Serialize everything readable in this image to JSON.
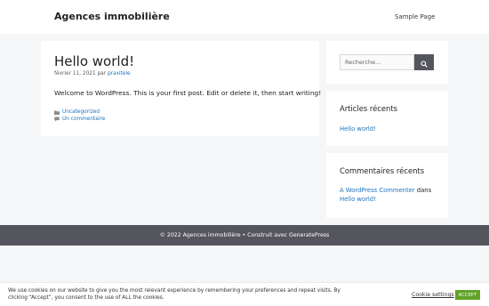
{
  "header": {
    "site_title": "Agences immobilière",
    "nav": [
      {
        "label": "Sample Page"
      }
    ]
  },
  "post": {
    "title": "Hello world!",
    "date": "février 11, 2021",
    "by": "par",
    "author": "praxitele",
    "body": "Welcome to WordPress. This is your first post. Edit or delete it, then start writing!",
    "category": "Uncategorized",
    "comments_link": "Un commentaire",
    "icons": [
      "folder-icon",
      "comment-icon"
    ]
  },
  "sidebar": {
    "search": {
      "placeholder": "Recherche...",
      "icon": "search-icon"
    },
    "recent_posts": {
      "title": "Articles récents",
      "items": [
        "Hello world!"
      ]
    },
    "recent_comments": {
      "title": "Commentaires récents",
      "items": [
        {
          "author": "A WordPress Commenter",
          "sep": "dans",
          "post": "Hello world!"
        }
      ]
    }
  },
  "footer": {
    "text": "© 2022 Agences immobilière • Construit avec GeneratePress"
  },
  "cookie": {
    "message": "We use cookies on our website to give you the most relevant experience by remembering your preferences and repeat visits. By clicking “Accept”, you consent to the use of ALL the cookies.",
    "settings_label": "Cookie settings",
    "accept_label": "ACCEPT"
  },
  "colors": {
    "link": "#1e73be",
    "footer_bg": "#55555e",
    "accept": "#61a229",
    "page_bg": "#f5f6f8"
  }
}
